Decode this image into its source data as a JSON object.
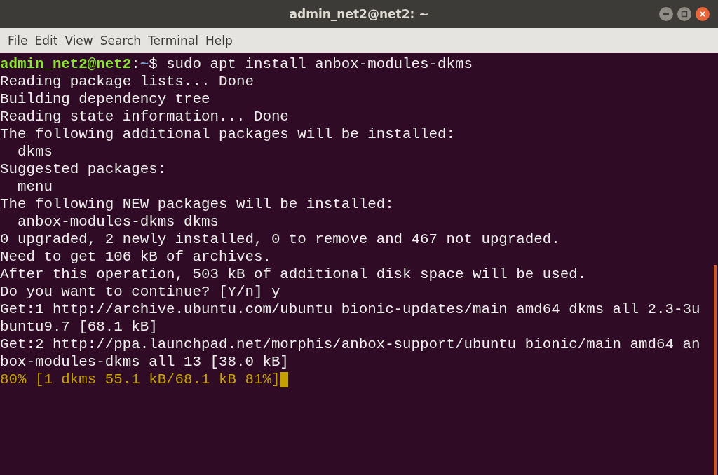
{
  "window": {
    "title": "admin_net2@net2: ~"
  },
  "menu": [
    "File",
    "Edit",
    "View",
    "Search",
    "Terminal",
    "Help"
  ],
  "lines": [
    {
      "kind": "prompt",
      "user": "admin_net2@net2",
      "separator": ":",
      "path": "~",
      "symbol": "$",
      "command": "sudo apt install anbox-modules-dkms"
    },
    {
      "kind": "output",
      "text": "Reading package lists... Done"
    },
    {
      "kind": "output",
      "text": "Building dependency tree"
    },
    {
      "kind": "output",
      "text": "Reading state information... Done"
    },
    {
      "kind": "output",
      "text": "The following additional packages will be installed:"
    },
    {
      "kind": "output",
      "text": "  dkms"
    },
    {
      "kind": "output",
      "text": "Suggested packages:"
    },
    {
      "kind": "output",
      "text": "  menu"
    },
    {
      "kind": "output",
      "text": "The following NEW packages will be installed:"
    },
    {
      "kind": "output",
      "text": "  anbox-modules-dkms dkms"
    },
    {
      "kind": "output",
      "text": "0 upgraded, 2 newly installed, 0 to remove and 467 not upgraded."
    },
    {
      "kind": "output",
      "text": "Need to get 106 kB of archives."
    },
    {
      "kind": "output",
      "text": "After this operation, 503 kB of additional disk space will be used."
    },
    {
      "kind": "output",
      "text": "Do you want to continue? [Y/n] y"
    },
    {
      "kind": "output",
      "text": "Get:1 http://archive.ubuntu.com/ubuntu bionic-updates/main amd64 dkms all 2.3-3u"
    },
    {
      "kind": "output",
      "text": "buntu9.7 [68.1 kB]"
    },
    {
      "kind": "output",
      "text": "Get:2 http://ppa.launchpad.net/morphis/anbox-support/ubuntu bionic/main amd64 an"
    },
    {
      "kind": "output",
      "text": "box-modules-dkms all 13 [38.0 kB]"
    },
    {
      "kind": "progress",
      "text": "80% [1 dkms 55.1 kB/68.1 kB 81%]"
    }
  ]
}
